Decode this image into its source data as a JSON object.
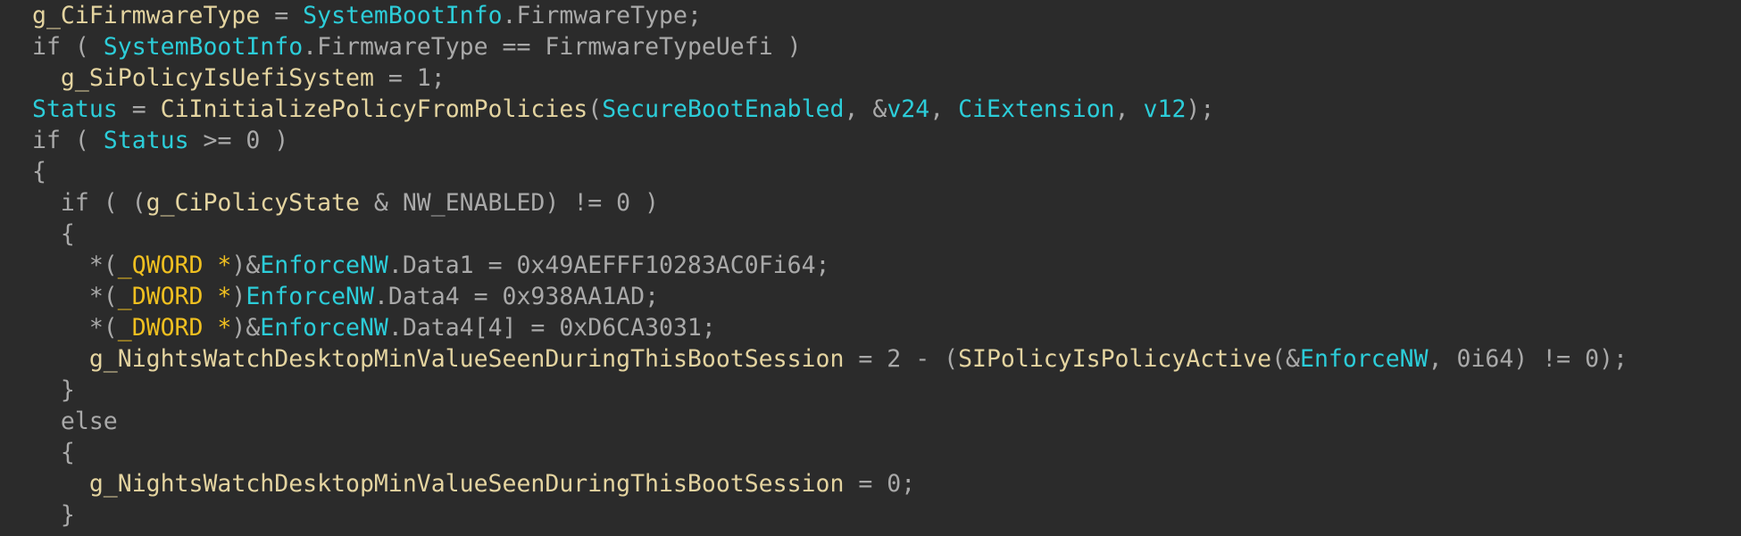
{
  "view": "pseudocode-decompiler",
  "colors": {
    "background": "#2b2b2b",
    "default_text": "#a9a9a9",
    "global_and_function": "#e4d4a0",
    "local_variable": "#2ccdd9",
    "type_cast": "#f0c020"
  },
  "lines": [
    {
      "tokens": [
        {
          "t": "g_CiFirmwareType",
          "k": "gvar"
        },
        {
          "t": " = ",
          "k": "op"
        },
        {
          "t": "SystemBootInfo",
          "k": "var"
        },
        {
          "t": ".FirmwareType;",
          "k": "field"
        }
      ]
    },
    {
      "tokens": [
        {
          "t": "if",
          "k": "kw"
        },
        {
          "t": " ( ",
          "k": "punct"
        },
        {
          "t": "SystemBootInfo",
          "k": "var"
        },
        {
          "t": ".FirmwareType == FirmwareTypeUefi )",
          "k": "field"
        }
      ]
    },
    {
      "tokens": [
        {
          "t": "  ",
          "k": "punct"
        },
        {
          "t": "g_SiPolicyIsUefiSystem",
          "k": "gvar"
        },
        {
          "t": " = ",
          "k": "op"
        },
        {
          "t": "1",
          "k": "num"
        },
        {
          "t": ";",
          "k": "punct"
        }
      ]
    },
    {
      "tokens": [
        {
          "t": "Status",
          "k": "var"
        },
        {
          "t": " = ",
          "k": "op"
        },
        {
          "t": "CiInitializePolicyFromPolicies",
          "k": "func"
        },
        {
          "t": "(",
          "k": "punct"
        },
        {
          "t": "SecureBootEnabled",
          "k": "var"
        },
        {
          "t": ", &",
          "k": "punct"
        },
        {
          "t": "v24",
          "k": "var"
        },
        {
          "t": ", ",
          "k": "punct"
        },
        {
          "t": "CiExtension",
          "k": "var"
        },
        {
          "t": ", ",
          "k": "punct"
        },
        {
          "t": "v12",
          "k": "var"
        },
        {
          "t": ");",
          "k": "punct"
        }
      ]
    },
    {
      "tokens": [
        {
          "t": "if",
          "k": "kw"
        },
        {
          "t": " ( ",
          "k": "punct"
        },
        {
          "t": "Status",
          "k": "var"
        },
        {
          "t": " >= 0 )",
          "k": "op"
        }
      ]
    },
    {
      "tokens": [
        {
          "t": "{",
          "k": "punct"
        }
      ]
    },
    {
      "tokens": [
        {
          "t": "  if ( (",
          "k": "kw"
        },
        {
          "t": "g_CiPolicyState",
          "k": "gvar"
        },
        {
          "t": " & NW_ENABLED) != 0 )",
          "k": "const"
        }
      ]
    },
    {
      "tokens": [
        {
          "t": "  {",
          "k": "punct"
        }
      ]
    },
    {
      "tokens": [
        {
          "t": "    *(",
          "k": "punct"
        },
        {
          "t": "_QWORD *",
          "k": "type"
        },
        {
          "t": ")&",
          "k": "punct"
        },
        {
          "t": "EnforceNW",
          "k": "var"
        },
        {
          "t": ".Data1 = 0x49AEFFF10283AC0Fi64;",
          "k": "field"
        }
      ]
    },
    {
      "tokens": [
        {
          "t": "    *(",
          "k": "punct"
        },
        {
          "t": "_DWORD *",
          "k": "type"
        },
        {
          "t": ")",
          "k": "punct"
        },
        {
          "t": "EnforceNW",
          "k": "var"
        },
        {
          "t": ".Data4 = 0x938AA1AD;",
          "k": "field"
        }
      ]
    },
    {
      "tokens": [
        {
          "t": "    *(",
          "k": "punct"
        },
        {
          "t": "_DWORD *",
          "k": "type"
        },
        {
          "t": ")&",
          "k": "punct"
        },
        {
          "t": "EnforceNW",
          "k": "var"
        },
        {
          "t": ".Data4[4] = 0xD6CA3031;",
          "k": "field"
        }
      ]
    },
    {
      "tokens": [
        {
          "t": "    ",
          "k": "punct"
        },
        {
          "t": "g_NightsWatchDesktopMinValueSeenDuringThisBootSession",
          "k": "gvar"
        },
        {
          "t": " = 2 - (",
          "k": "op"
        },
        {
          "t": "SIPolicyIsPolicyActive",
          "k": "func"
        },
        {
          "t": "(&",
          "k": "punct"
        },
        {
          "t": "EnforceNW",
          "k": "var"
        },
        {
          "t": ", 0i64) != 0);",
          "k": "num"
        }
      ]
    },
    {
      "tokens": [
        {
          "t": "  }",
          "k": "punct"
        }
      ]
    },
    {
      "tokens": [
        {
          "t": "  else",
          "k": "kw"
        }
      ]
    },
    {
      "tokens": [
        {
          "t": "  {",
          "k": "punct"
        }
      ]
    },
    {
      "tokens": [
        {
          "t": "    ",
          "k": "punct"
        },
        {
          "t": "g_NightsWatchDesktopMinValueSeenDuringThisBootSession",
          "k": "gvar"
        },
        {
          "t": " = 0;",
          "k": "op"
        }
      ]
    },
    {
      "tokens": [
        {
          "t": "  }",
          "k": "punct"
        }
      ]
    }
  ]
}
